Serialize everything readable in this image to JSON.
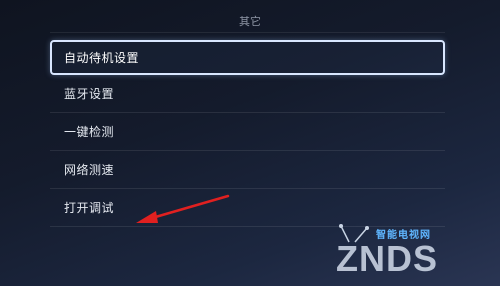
{
  "header": {
    "title": "其它"
  },
  "menu": {
    "items": [
      {
        "label": "自动待机设置",
        "focused": true
      },
      {
        "label": "蓝牙设置",
        "focused": false
      },
      {
        "label": "一键检测",
        "focused": false
      },
      {
        "label": "网络测速",
        "focused": false
      },
      {
        "label": "打开调试",
        "focused": false
      }
    ]
  },
  "annotation": {
    "color": "#e02020",
    "icon": "red-arrow-icon"
  },
  "watermark": {
    "small": "智能电视网",
    "brand": "ZNDS"
  }
}
